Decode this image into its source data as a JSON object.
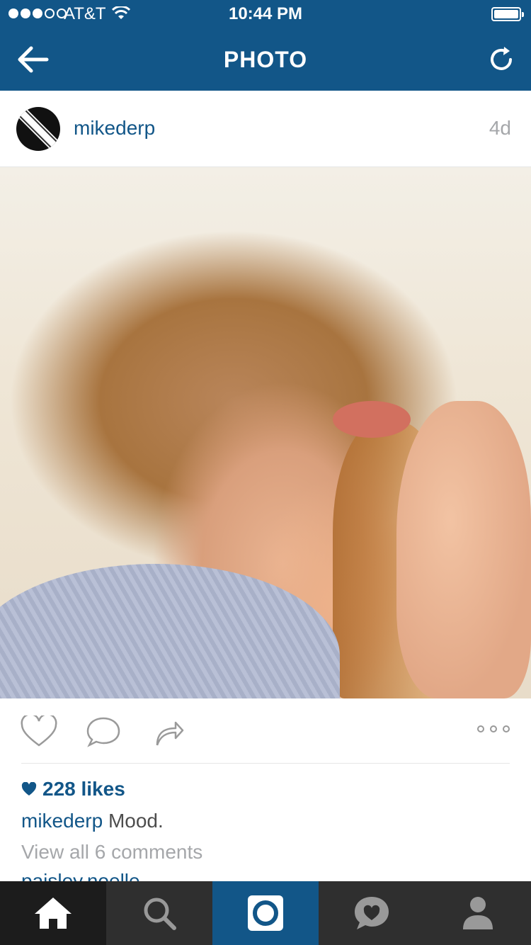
{
  "status_bar": {
    "carrier": "AT&T",
    "time": "10:44 PM",
    "signal_strength": 3,
    "signal_max": 5,
    "battery_level": 1.0
  },
  "nav_bar": {
    "title": "PHOTO"
  },
  "post": {
    "username": "mikederp",
    "age": "4d",
    "likes_text": "228 likes",
    "caption_user": "mikederp",
    "caption_text": "Mood.",
    "view_comments": "View all 6 comments",
    "next_comment_user": "paisley.noelle"
  },
  "icons": {
    "back": "back-arrow-icon",
    "refresh": "refresh-icon",
    "like": "heart-outline-icon",
    "comment": "comment-icon",
    "share": "share-arrow-icon",
    "more": "more-dots-icon",
    "likes_heart": "heart-filled-icon",
    "tabs": [
      "home-icon",
      "search-icon",
      "camera-icon",
      "activity-icon",
      "profile-icon"
    ]
  },
  "colors": {
    "brand": "#125688",
    "tab_bar": "#2f2f2f",
    "tab_active": "#1c1c1c",
    "muted_text": "#a5a7aa"
  }
}
